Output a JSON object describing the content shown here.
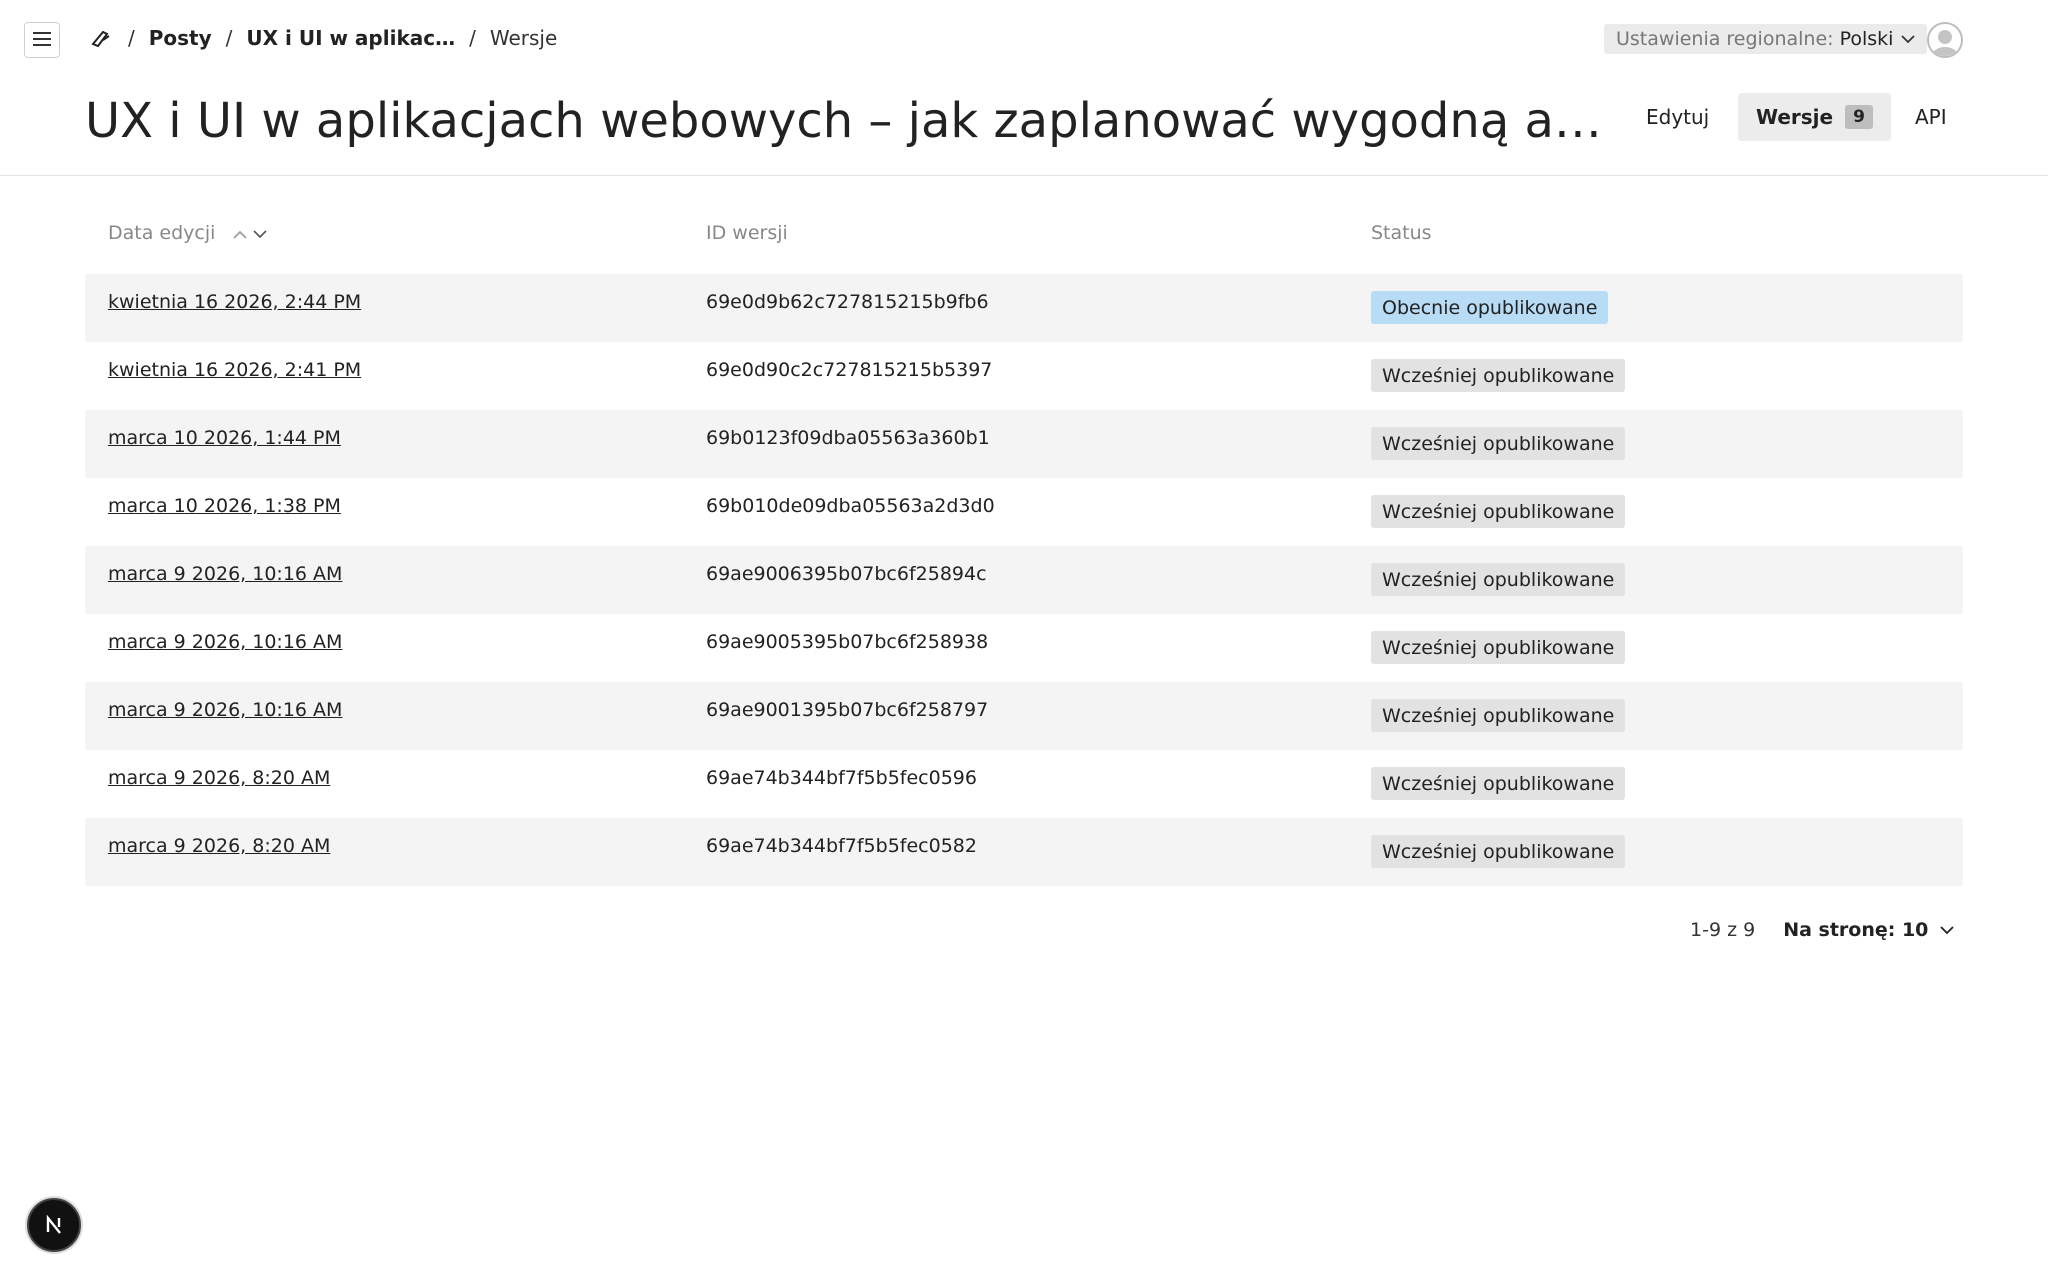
{
  "breadcrumb": {
    "items": [
      "Posty",
      "UX i UI w aplikac…"
    ],
    "current": "Wersje",
    "separator": "/"
  },
  "locale": {
    "label": "Ustawienia regionalne:",
    "value": "Polski"
  },
  "page": {
    "title": "UX i UI w aplikacjach webowych – jak zaplanować wygodną aplik…"
  },
  "tabs": {
    "edit": "Edytuj",
    "versions": "Wersje",
    "versions_count": "9",
    "api": "API"
  },
  "table": {
    "headers": {
      "date": "Data edycji",
      "id": "ID wersji",
      "status": "Status"
    },
    "rows": [
      {
        "date": "kwietnia 16 2026, 2:44 PM",
        "id": "69e0d9b62c727815215b9fb6",
        "status": "Obecnie opublikowane",
        "current": true
      },
      {
        "date": "kwietnia 16 2026, 2:41 PM",
        "id": "69e0d90c2c727815215b5397",
        "status": "Wcześniej opublikowane",
        "current": false
      },
      {
        "date": "marca 10 2026, 1:44 PM",
        "id": "69b0123f09dba05563a360b1",
        "status": "Wcześniej opublikowane",
        "current": false
      },
      {
        "date": "marca 10 2026, 1:38 PM",
        "id": "69b010de09dba05563a2d3d0",
        "status": "Wcześniej opublikowane",
        "current": false
      },
      {
        "date": "marca 9 2026, 10:16 AM",
        "id": "69ae9006395b07bc6f25894c",
        "status": "Wcześniej opublikowane",
        "current": false
      },
      {
        "date": "marca 9 2026, 10:16 AM",
        "id": "69ae9005395b07bc6f258938",
        "status": "Wcześniej opublikowane",
        "current": false
      },
      {
        "date": "marca 9 2026, 10:16 AM",
        "id": "69ae9001395b07bc6f258797",
        "status": "Wcześniej opublikowane",
        "current": false
      },
      {
        "date": "marca 9 2026, 8:20 AM",
        "id": "69ae74b344bf7f5b5fec0596",
        "status": "Wcześniej opublikowane",
        "current": false
      },
      {
        "date": "marca 9 2026, 8:20 AM",
        "id": "69ae74b344bf7f5b5fec0582",
        "status": "Wcześniej opublikowane",
        "current": false
      }
    ]
  },
  "pagination": {
    "range": "1-9 z 9",
    "per_page": "Na stronę: 10"
  },
  "colors": {
    "current_badge": "#b8dcf5",
    "previous_badge": "#e2e2e2",
    "row_alt": "#f4f4f4"
  },
  "icons": {
    "menu": "hamburger-icon",
    "logo": "payload-logo-icon",
    "locale_chevron": "chevron-down-icon",
    "avatar": "user-avatar-icon",
    "sort": [
      "sort-asc-icon",
      "sort-desc-icon"
    ],
    "per_page_chevron": "chevron-down-icon",
    "framework_badge": "nextjs-icon"
  }
}
